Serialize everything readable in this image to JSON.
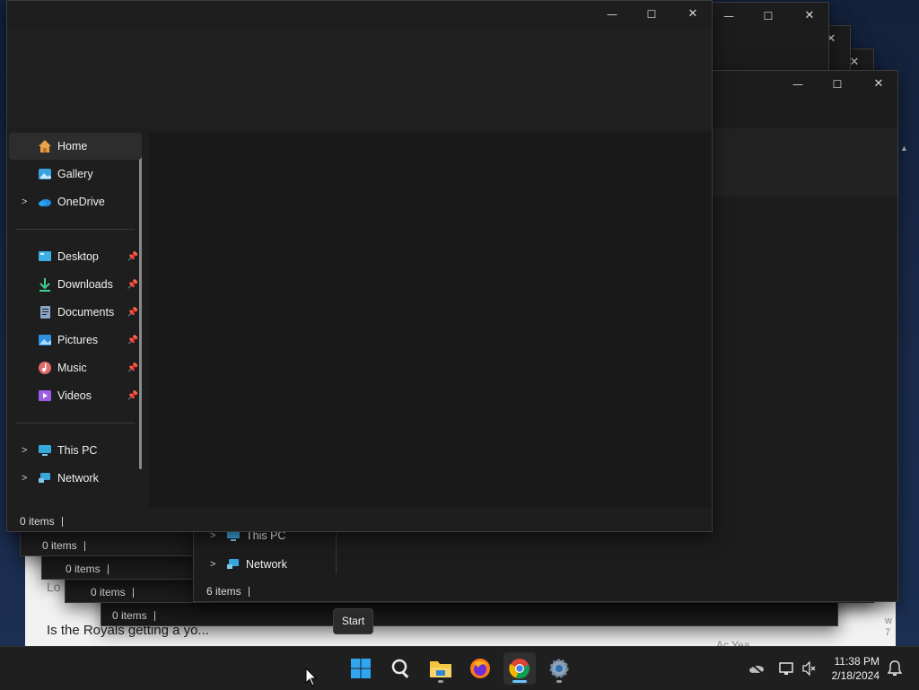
{
  "desktop": {
    "page_line1": "Lo",
    "page_line2": "Is the Royals getting a yo...",
    "page_side_text": "Ac Yea",
    "page_edge_chars": "w\n7"
  },
  "background_windows": [
    {
      "status": "0 items"
    },
    {
      "status": "0 items"
    },
    {
      "status": "0 items"
    },
    {
      "status": "0 items"
    }
  ],
  "back_window": {
    "nav_items": [
      {
        "label": "This PC"
      },
      {
        "label": "Network"
      }
    ],
    "status": "6 items"
  },
  "main_window": {
    "caption": {
      "minimize": "—",
      "maximize": "☐",
      "close": "✕"
    },
    "nav_items": [
      {
        "label": "Home",
        "icon": "home-icon",
        "active": true
      },
      {
        "label": "Gallery",
        "icon": "gallery-icon"
      },
      {
        "label": "OneDrive",
        "icon": "onedrive-icon",
        "expandable": true
      },
      {
        "label": "Desktop",
        "icon": "desktop-folder-icon",
        "pinned": true
      },
      {
        "label": "Downloads",
        "icon": "downloads-icon",
        "pinned": true
      },
      {
        "label": "Documents",
        "icon": "documents-icon",
        "pinned": true
      },
      {
        "label": "Pictures",
        "icon": "pictures-icon",
        "pinned": true
      },
      {
        "label": "Music",
        "icon": "music-icon",
        "pinned": true
      },
      {
        "label": "Videos",
        "icon": "videos-icon",
        "pinned": true
      },
      {
        "label": "This PC",
        "icon": "this-pc-icon",
        "expandable": true
      },
      {
        "label": "Network",
        "icon": "network-icon",
        "expandable": true
      }
    ],
    "status": "0 items"
  },
  "tooltip": "Start",
  "taskbar": {
    "apps": [
      "start-icon",
      "search-icon",
      "file-explorer-icon",
      "firefox-icon",
      "chrome-icon",
      "settings-icon"
    ],
    "time": "11:38 PM",
    "date": "2/18/2024"
  }
}
